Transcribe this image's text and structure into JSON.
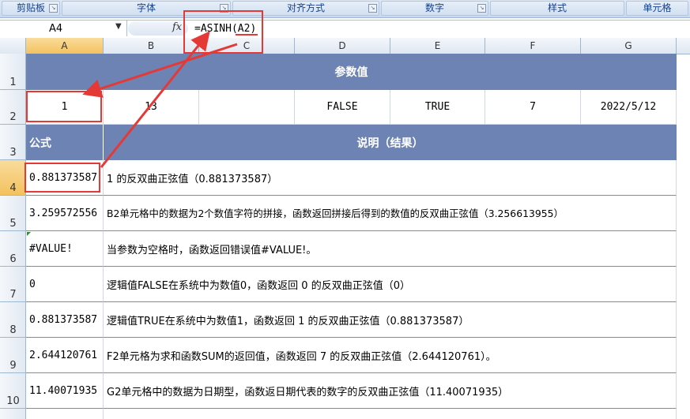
{
  "ribbon": {
    "groups": [
      "剪贴板",
      "字体",
      "对齐方式",
      "数字",
      "样式",
      "单元格"
    ]
  },
  "formula_bar": {
    "name_box": "A4",
    "fx_label": "fx",
    "formula": "=ASINH(A2)"
  },
  "columns": [
    "A",
    "B",
    "C",
    "D",
    "E",
    "F",
    "G"
  ],
  "rows": [
    "1",
    "2",
    "3",
    "4",
    "5",
    "6",
    "7",
    "8",
    "9",
    "10"
  ],
  "selected_cell": "A4",
  "sheet": {
    "title": "参数值",
    "params": [
      "1",
      "13",
      "",
      "FALSE",
      "TRUE",
      "7",
      "2022/5/12"
    ],
    "formula_header": "公式",
    "desc_header": "说明（结果）",
    "results": [
      {
        "value": "0.881373587",
        "desc": "1 的反双曲正弦值（0.881373587）"
      },
      {
        "value": "3.259572556",
        "desc": "B2单元格中的数据为2个数值字符的拼接，函数返回拼接后得到的数值的反双曲正弦值（3.256613955）"
      },
      {
        "value": "#VALUE!",
        "desc": "当参数为空格时，函数返回错误值#VALUE!。"
      },
      {
        "value": "0",
        "desc": "逻辑值FALSE在系统中为数值0，函数返回 0 的反双曲正弦值（0）"
      },
      {
        "value": "0.881373587",
        "desc": "逻辑值TRUE在系统中为数值1，函数返回 1 的反双曲正弦值（0.881373587）"
      },
      {
        "value": "2.644120761",
        "desc": "F2单元格为求和函数SUM的返回值，函数返回 7 的反双曲正弦值（2.644120761）。"
      },
      {
        "value": "11.40071935",
        "desc": "G2单元格中的数据为日期型，函数返日期代表的数字的反双曲正弦值（11.40071935）"
      }
    ]
  },
  "colors": {
    "header_fill": "#6d83b3",
    "annotation_red": "#e53935",
    "selected_header": "#f3c25e"
  }
}
